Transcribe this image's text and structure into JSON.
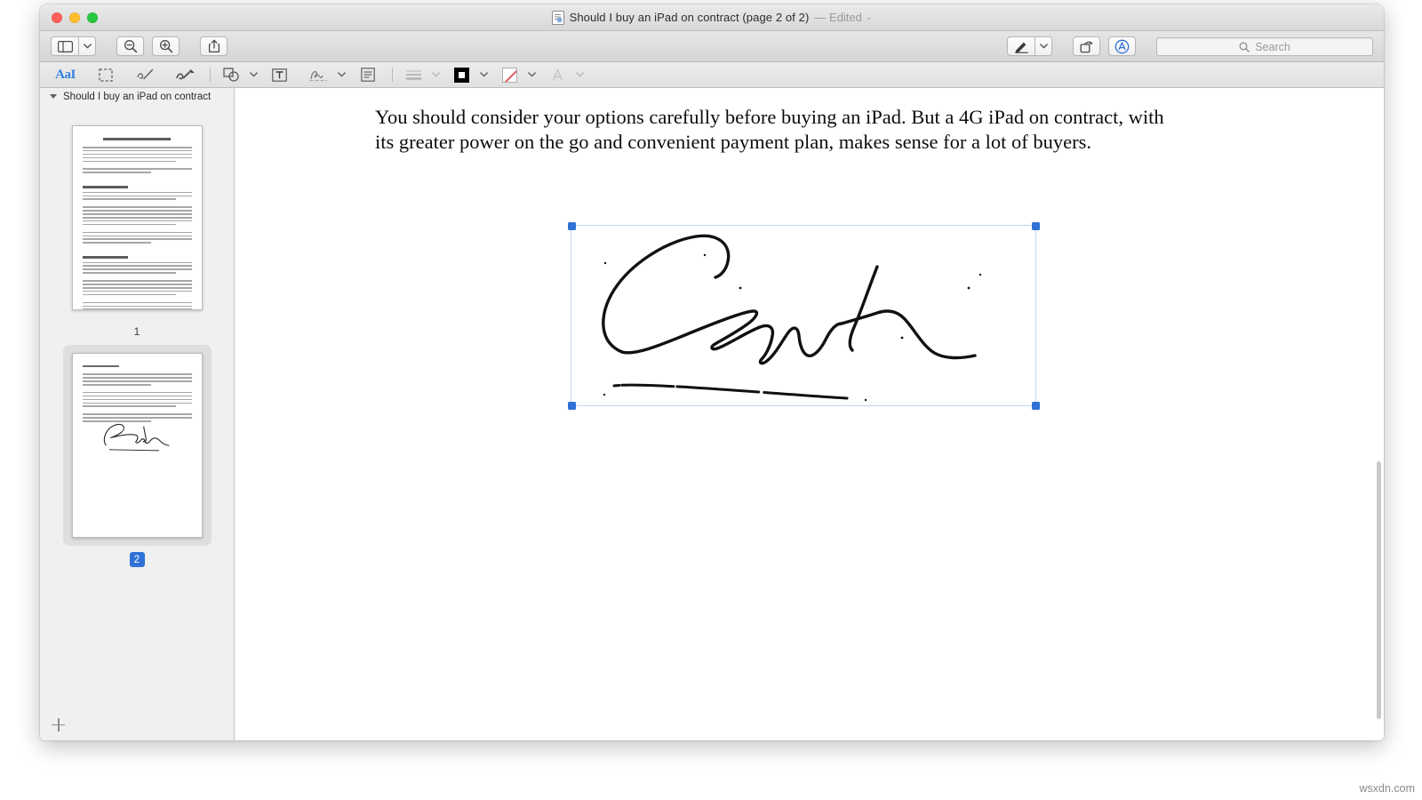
{
  "window": {
    "title": "Should I buy an iPad on contract (page 2 of 2)",
    "edited_label": "— Edited",
    "chevron": "⌄",
    "doc_icon": "document-icon"
  },
  "traffic_lights": {
    "close": "close-button",
    "minimize": "minimize-button",
    "zoom": "zoom-button"
  },
  "toolbar": {
    "sidebar_toggle": "sidebar-icon",
    "sidebar_caret": "⌄",
    "zoom_out": "zoom-out-icon",
    "zoom_in": "zoom-in-icon",
    "share": "share-icon",
    "markup": "markup-pen-icon",
    "markup_caret": "⌄",
    "rotate": "rotate-icon",
    "annotate": "annotate-icon"
  },
  "search": {
    "placeholder": "Search",
    "icon": "search-icon"
  },
  "markup_toolbar": {
    "text_selection_label": "AaI",
    "items": [
      {
        "name": "text-selection-tool",
        "label": "AaI"
      },
      {
        "name": "rectangular-selection-tool",
        "label": ""
      },
      {
        "name": "sketch-tool",
        "label": ""
      },
      {
        "name": "draw-tool",
        "label": ""
      },
      {
        "name": "shapes-tool",
        "label": ""
      },
      {
        "name": "text-box-tool",
        "label": ""
      },
      {
        "name": "signature-tool",
        "label": ""
      },
      {
        "name": "note-tool",
        "label": ""
      },
      {
        "name": "border-style-tool",
        "label": ""
      },
      {
        "name": "border-color-tool",
        "label": ""
      },
      {
        "name": "fill-color-tool",
        "label": ""
      },
      {
        "name": "text-style-tool",
        "label": "A"
      }
    ],
    "caret": "⌄"
  },
  "sidebar": {
    "header_title": "Should I buy an iPad on contract",
    "pages": [
      {
        "label": "1",
        "selected": false
      },
      {
        "label": "2",
        "selected": true
      }
    ],
    "add_page": "add-page-icon"
  },
  "document": {
    "paragraph": "You should consider your options carefully before buying an iPad. But a 4G iPad on contract, with its greater power on the go and convenient payment plan, makes sense for a lot of buyers.",
    "signature_alt": "handwritten-signature"
  },
  "watermark": "wsxdn.com",
  "colors": {
    "accent": "#2f72d8",
    "selection_outline": "#c3d4ea",
    "toolbar_bg": "#e0e0e0",
    "sidebar_bg": "#f0f0f0"
  }
}
